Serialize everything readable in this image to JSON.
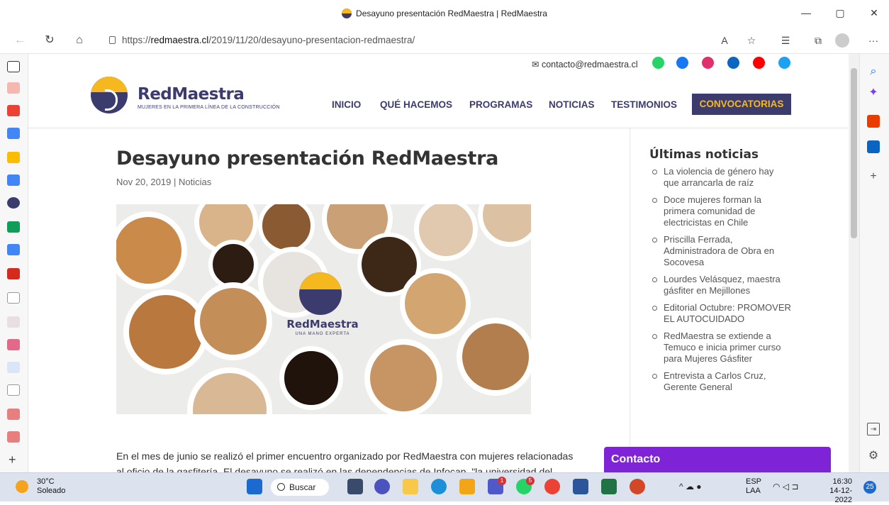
{
  "browser": {
    "window_title": "Desayuno presentación RedMaestra | RedMaestra",
    "url_prefix": "https://",
    "url_domain": "redmaestra.cl",
    "url_path": "/2019/11/20/desayuno-presentacion-redmaestra/",
    "more_label": "···"
  },
  "site": {
    "email": "contacto@redmaestra.cl",
    "brand": "RedMaestra",
    "tagline": "MUJERES EN LA PRIMERA LÍNEA DE LA CONSTRUCCIÓN",
    "menu": [
      "INICIO",
      "QUÉ HACEMOS",
      "PROGRAMAS",
      "NOTICIAS",
      "TESTIMONIOS",
      "CONVOCATORIAS"
    ],
    "social": [
      {
        "name": "whatsapp-icon",
        "color": "#25d366"
      },
      {
        "name": "facebook-icon",
        "color": "#1877f2"
      },
      {
        "name": "instagram-icon",
        "color": "#e1306c"
      },
      {
        "name": "linkedin-icon",
        "color": "#0a66c2"
      },
      {
        "name": "youtube-icon",
        "color": "#ff0000"
      },
      {
        "name": "twitter-icon",
        "color": "#1da1f2"
      }
    ],
    "colors": {
      "primary": "#3c3b6e",
      "accent": "#f5b81f",
      "contact": "#7e24d6"
    }
  },
  "article": {
    "title": "Desayuno presentación RedMaestra",
    "date": "Nov 20, 2019",
    "separator": " | ",
    "category": "Noticias",
    "hero_brand": "RedMaestra",
    "hero_sub": "UNA MANO EXPERTA",
    "paragraph_1": "En el mes de junio se realizó el primer encuentro organizado por RedMaestra con mujeres relacionadas",
    "paragraph_2": "al oficio de la gasfitería. El desayuno se realizó en las dependencias de Infocap, \"la universidad del"
  },
  "sidebar": {
    "heading": "Últimas noticias",
    "items": [
      "La violencia de género hay que arrancarla de raíz",
      "Doce mujeres forman la primera comunidad de electricistas en Chile",
      "Priscilla Ferrada, Administradora de Obra en Socovesa",
      "Lourdes Velásquez, maestra gásfiter en Mejillones",
      "Editorial Octubre: PROMOVER EL AUTOCUIDADO",
      "RedMaestra se extiende a Temuco e inicia primer curso para Mujeres Gásfiter",
      "Entrevista a Carlos Cruz, Gerente General"
    ],
    "contact_label": "Contacto"
  },
  "taskbar": {
    "temp": "30°C",
    "weather": "Soleado",
    "search": "Buscar",
    "lang": "ESP",
    "layout": "LAA",
    "time": "16:30",
    "date": "14-12-2022",
    "notifications": "25",
    "badge_teams": "1",
    "badge_whatsapp": "5"
  }
}
